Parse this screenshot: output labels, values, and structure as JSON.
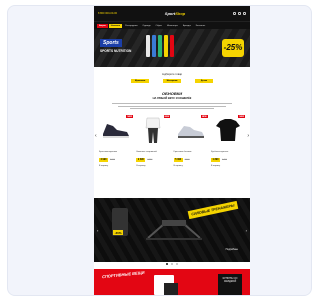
{
  "topbar": {
    "phone": "8 800 000-00-00",
    "logo_part1": "Sport",
    "logo_part2": "Shop"
  },
  "nav": {
    "items": [
      "Акции",
      "Новинки",
      "Распродажа",
      "Одежда",
      "Обувь",
      "Инвентарь",
      "Бренды",
      "Контакты"
    ]
  },
  "hero": {
    "brand": "Sports",
    "caption": "SPORTS NUTRITION",
    "badge": "-25%",
    "colors": {
      "bottle1": "#e8e8e8",
      "bottle2": "#3a7bd5",
      "bottle3": "#2bb673",
      "bottle4": "#f5d400",
      "bottle5": "#e30613"
    }
  },
  "filters": {
    "title": "подберите товар",
    "chips": [
      "Мужчинам",
      "Женщинам",
      "Детям"
    ]
  },
  "section": {
    "heading": "ОБНОВКИ",
    "subheading": "НА ЛЮБОЙ ВКУС И КОШЕЛЁК"
  },
  "products": [
    {
      "tag": "NEW",
      "name": "Кроссовки мужские",
      "price": "4 990",
      "old": "6 990",
      "cart": "В корзину"
    },
    {
      "tag": "NEW",
      "name": "Комплект спортивный",
      "price": "2 490",
      "old": "3 290",
      "cart": "В корзину"
    },
    {
      "tag": "NEW",
      "name": "Кроссовки беговые",
      "price": "5 490",
      "old": "7 190",
      "cart": "В корзину"
    },
    {
      "tag": "NEW",
      "name": "Футболка мужская",
      "price": "1 290",
      "old": "1 790",
      "cart": "В корзину"
    }
  ],
  "dark_banner": {
    "box_tag": "-30%",
    "slogan": "СИЛОВЫЕ ТРЕНАЖЕРЫ",
    "cta": "Подробнее"
  },
  "red_banner": {
    "title": "СПОРТИВНЫЕ ВЕЩИ",
    "tag": "КУПИТЬ СО СКИДКОЙ"
  },
  "colors": {
    "accent_yellow": "#f5d400",
    "accent_red": "#e30613",
    "dark": "#111111"
  }
}
